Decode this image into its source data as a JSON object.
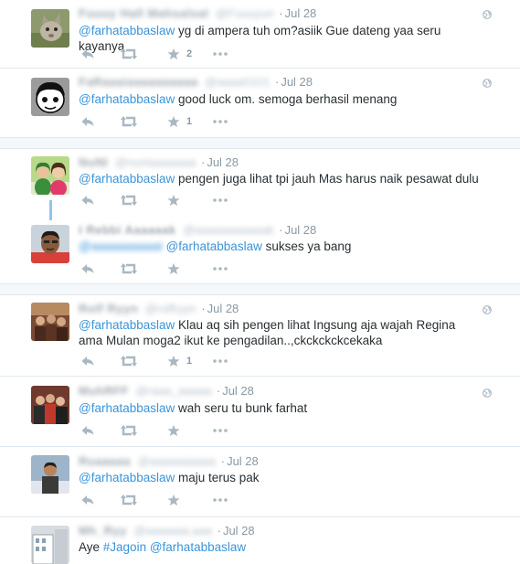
{
  "tweets": [
    {
      "name": "Fuuuy Hall Mahsalsal",
      "handle": "@Fuuuyun",
      "date": "Jul 28",
      "mention": "@farhatabbaslaw",
      "text": " yg di ampera tuh om?asiik  Gue dateng yaa seru kayanya",
      "fav_count": "2",
      "avatar_icon": "cat-avatar"
    },
    {
      "name": "FaRaaaiaaaaaaaaaa",
      "handle": "@aaaa0101",
      "date": "Jul 28",
      "mention": "@farhatabbaslaw",
      "text": " good luck om. semoga berhasil menang",
      "fav_count": "1",
      "avatar_icon": "cartoon-avatar"
    },
    {
      "name": "NuNI",
      "handle": "@nuniaaaaaaa",
      "date": "Jul 28",
      "mention": "@farhatabbaslaw",
      "text": " pengen juga lihat tpi jauh Mas harus naik pesawat dulu",
      "fav_count": "",
      "avatar_icon": "two-women-avatar"
    },
    {
      "name": "I Rebbi Aaaaaak",
      "handle": "@aaaaaaaaaaak",
      "date": "Jul 28",
      "reply_handle": "@aaaaaaaaaai",
      "mention": "@farhatabbaslaw",
      "text": " sukses ya bang",
      "fav_count": "",
      "avatar_icon": "man-avatar"
    },
    {
      "name": "Rolf Ryyn",
      "handle": "@rolfryyn",
      "date": "Jul 28",
      "mention": "@farhatabbaslaw",
      "text": "  Klau aq sih pengen lihat Ingsung aja wajah Regina ama Mulan moga2 ikut ke pengadilan..,ckckckckcekaka",
      "fav_count": "1",
      "avatar_icon": "event-avatar"
    },
    {
      "name": "MuhRFF",
      "handle": "@raaa_aaaaa",
      "date": "Jul 28",
      "mention": "@farhatabbaslaw",
      "text": "  wah seru tu bunk farhat",
      "fav_count": "",
      "avatar_icon": "group-avatar"
    },
    {
      "name": "Ruaaaaa",
      "handle": "@aaaaaaaaaa",
      "date": "Jul 28",
      "mention": "@farhatabbaslaw",
      "text": " maju terus pak",
      "fav_count": "",
      "avatar_icon": "person-avatar"
    },
    {
      "name": "Mh_Ryy",
      "handle": "@aaaaaaLaaa",
      "date": "Jul 28",
      "prefix": "Aye ",
      "hashtag": "#Jagoin",
      "mention": "@farhatabbaslaw",
      "text": "",
      "fav_count": "",
      "avatar_icon": "building-avatar"
    }
  ],
  "icons": {
    "reply": "reply-icon",
    "retweet": "retweet-icon",
    "favorite": "star-icon",
    "more": "more-icon",
    "globe": "globe-icon"
  },
  "colors": {
    "link": "#3b94d9",
    "meta": "#8899a6",
    "action": "#aab8c2",
    "separator": "#f5f8fa",
    "thread": "#8fc8e8"
  }
}
